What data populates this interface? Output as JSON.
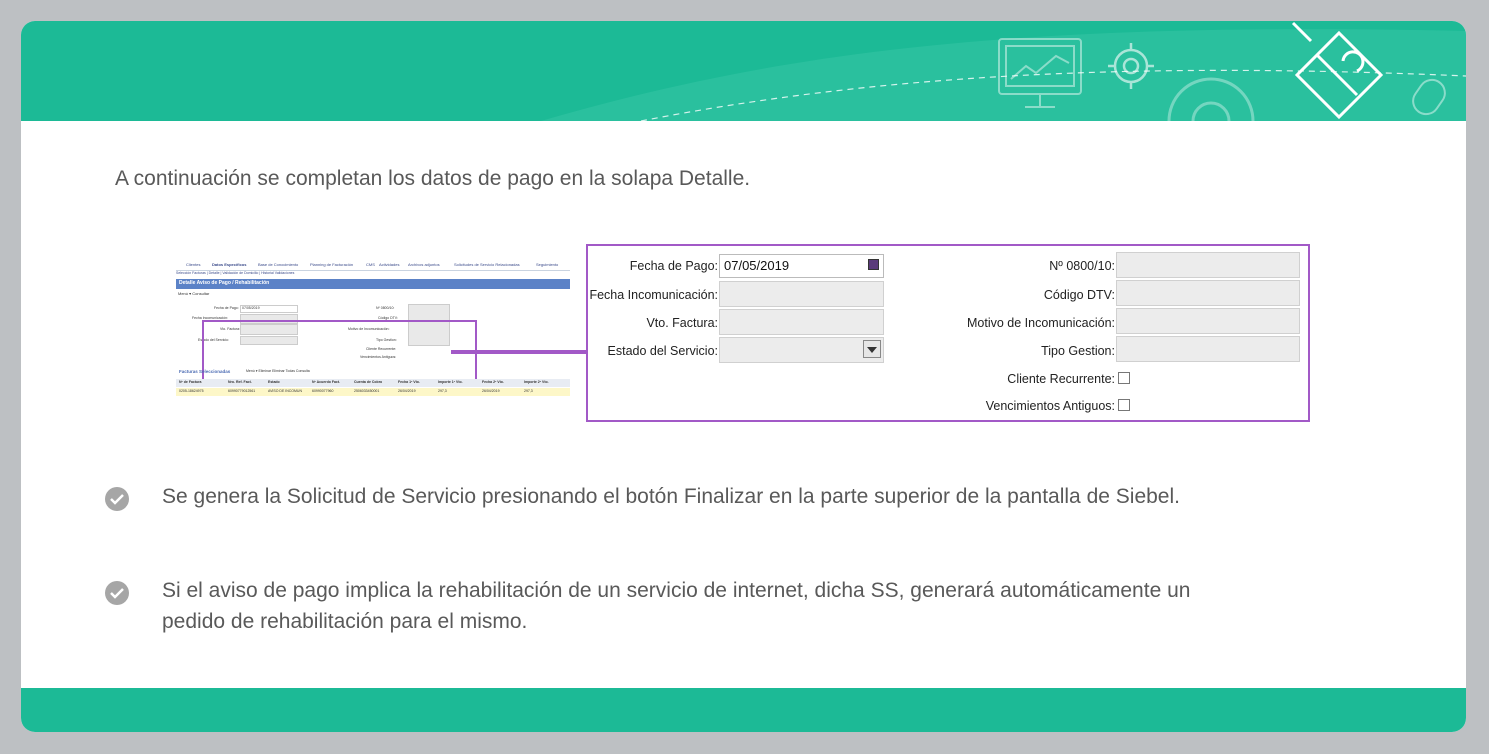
{
  "intro": "A continuación se completan los datos de pago en la solapa Detalle.",
  "bullets": [
    "Se genera la Solicitud de Servicio presionando el botón Finalizar en la parte superior de la pantalla de Siebel.",
    "Si el aviso de pago implica la rehabilitación de un servicio de internet, dicha SS, generará automáticamente un pedido de rehabilitación para el mismo."
  ],
  "mini": {
    "tabs": [
      "Clientes",
      "Datos Específicos",
      "Base de Conocimiento",
      "Planning de Facturación",
      "CMS",
      "Actividades",
      "Archivos adjuntos",
      "Solicitudes de Servicio Relacionadas",
      "Seguimiento"
    ],
    "subtabs": "Selección Facturas | Detalle | Validación de Domicilio | Historial Validaciones",
    "title": "Detalle Aviso de Pago / Rehabilitación",
    "buttons": "Menú ▾    Consultar",
    "left_labels": [
      "Fecha de Pago:",
      "Fecha Incomunicación:",
      "Vto. Factura:",
      "Estado del Servicio:"
    ],
    "fecha_value": "07/05/2019",
    "right_labels": [
      "Nº 0800/10:",
      "Código DTV:",
      "Motivo de Incomunicación:",
      "Tipo Gestion:",
      "Cliente Recurrente:",
      "Vencimientos Antiguos:"
    ],
    "facts_title": "Facturas Seleccionadas",
    "facts_buttons": "Menú ▾    Eliminar    Eliminar Todas    Consulta",
    "headers": [
      "Nº de Factura",
      "Nro. Ref. Fact.",
      "Estado",
      "Nº Acuerdo Fact.",
      "Cuenta de Cobro",
      "Fecha 1º Vto.",
      "Importe 1º Vto.",
      "Fecha 2º Vto.",
      "Importe 2º Vto."
    ],
    "row": [
      "0205-18624975",
      "60990779012561",
      "AVISO DE INCOMUN",
      "60990077960",
      "2506033450001",
      "26/04/2019",
      "297,3",
      "26/04/2019",
      "297,3"
    ]
  },
  "form": {
    "fecha_pago_label": "Fecha de Pago:",
    "fecha_pago_value": "07/05/2019",
    "fecha_incom_label": "Fecha Incomunicación:",
    "vto_factura_label": "Vto. Factura:",
    "estado_servicio_label": "Estado del Servicio:",
    "n0800_label": "Nº 0800/10:",
    "codigo_dtv_label": "Código DTV:",
    "motivo_label": "Motivo de Incomunicación:",
    "tipo_gestion_label": "Tipo Gestion:",
    "cliente_recurrente_label": "Cliente Recurrente:",
    "vencimientos_label": "Vencimientos Antiguos:"
  },
  "colors": {
    "header_teal": "#1cba96",
    "highlight_purple": "#a259c7",
    "text_gray": "#595959"
  }
}
